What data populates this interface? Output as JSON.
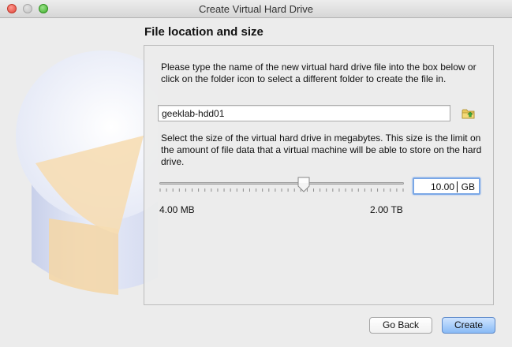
{
  "window": {
    "title": "Create Virtual Hard Drive"
  },
  "page": {
    "title": "File location and size"
  },
  "location": {
    "description": "Please type the name of the new virtual hard drive file into the box below or click on the folder icon to select a different folder to create the file in.",
    "value": "geeklab-hdd01",
    "folder_icon": "folder-icon"
  },
  "size": {
    "description": "Select the size of the virtual hard drive in megabytes. This size is the limit on the amount of file data that a virtual machine will be able to store on the hard drive.",
    "min_label": "4.00 MB",
    "max_label": "2.00 TB",
    "value": "10.00",
    "unit": "GB",
    "slider_position": 0.59
  },
  "buttons": {
    "back": "Go Back",
    "create": "Create"
  },
  "colors": {
    "accent": "#89bbf6",
    "focus_ring": "#7aa7e6"
  }
}
